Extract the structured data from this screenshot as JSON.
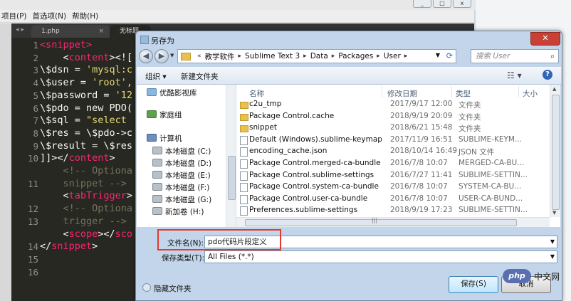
{
  "sublime": {
    "menu": [
      "项目(P)",
      "首选项(N)",
      "帮助(H)"
    ],
    "tab_nav": "◂ ▸",
    "tabs": [
      {
        "label": "1.php",
        "close": "×"
      },
      {
        "label": "无标题"
      }
    ],
    "line_numbers": [
      "1",
      "2",
      "3",
      "4",
      "5",
      "6",
      "7",
      "8",
      "9",
      "10",
      "",
      "11",
      "",
      "12",
      "13",
      "",
      "14",
      "15",
      "16"
    ],
    "code_lines": [
      [
        {
          "t": "<",
          "c": "tag"
        },
        {
          "t": "snippet",
          "c": "tag"
        },
        {
          "t": ">",
          "c": "tag"
        }
      ],
      [
        {
          "t": "    <",
          "c": "p"
        },
        {
          "t": "content",
          "c": "tag"
        },
        {
          "t": "><![",
          "c": "p"
        }
      ],
      [
        {
          "t": "\\$dsn = ",
          "c": "p"
        },
        {
          "t": "'mysql:c",
          "c": "str"
        }
      ],
      [
        {
          "t": "\\$user = ",
          "c": "p"
        },
        {
          "t": "'root',",
          "c": "str"
        }
      ],
      [
        {
          "t": "\\$password = ",
          "c": "p"
        },
        {
          "t": "'12",
          "c": "str"
        }
      ],
      [
        {
          "t": "\\$pdo = new PDO(",
          "c": "p"
        }
      ],
      [
        {
          "t": "\\$sql = ",
          "c": "p"
        },
        {
          "t": "\"select ",
          "c": "str"
        }
      ],
      [
        {
          "t": "\\$res = \\$pdo->c",
          "c": "p"
        }
      ],
      [
        {
          "t": "\\$result = \\$res",
          "c": "p"
        }
      ],
      [
        {
          "t": "]]></",
          "c": "p"
        },
        {
          "t": "content",
          "c": "tag"
        },
        {
          "t": ">",
          "c": "p"
        }
      ],
      [
        {
          "t": "    <!-- Optiona",
          "c": "cmt"
        }
      ],
      [
        {
          "t": "    snippet -->",
          "c": "cmt"
        }
      ],
      [
        {
          "t": "    <",
          "c": "p"
        },
        {
          "t": "tabTrigger",
          "c": "tag"
        },
        {
          "t": ">",
          "c": "p"
        }
      ],
      [
        {
          "t": "    <!-- Optiona",
          "c": "cmt"
        }
      ],
      [
        {
          "t": "    trigger -->",
          "c": "cmt"
        }
      ],
      [
        {
          "t": "    <",
          "c": "p"
        },
        {
          "t": "scope",
          "c": "tag"
        },
        {
          "t": "></",
          "c": "p"
        },
        {
          "t": "sco",
          "c": "tag"
        }
      ],
      [
        {
          "t": "</",
          "c": "p"
        },
        {
          "t": "snippet",
          "c": "tag"
        },
        {
          "t": ">",
          "c": "p"
        }
      ],
      [
        {
          "t": "",
          "c": "p"
        }
      ]
    ]
  },
  "dialog": {
    "title": "另存为",
    "close": "✕",
    "address": [
      "教学软件",
      "Sublime Text 3",
      "Data",
      "Packages",
      "User"
    ],
    "search_placeholder": "搜索 User",
    "organize": "组织 ▾",
    "new_folder": "新建文件夹",
    "nav_items": [
      {
        "label": "优酷影视库",
        "kind": "cloud"
      },
      {
        "label": "家庭组",
        "kind": "home"
      },
      {
        "label": "计算机",
        "kind": "comp"
      },
      {
        "label": "本地磁盘 (C:)",
        "kind": "disk"
      },
      {
        "label": "本地磁盘 (D:)",
        "kind": "disk"
      },
      {
        "label": "本地磁盘 (E:)",
        "kind": "disk"
      },
      {
        "label": "本地磁盘 (F:)",
        "kind": "disk"
      },
      {
        "label": "本地磁盘 (G:)",
        "kind": "disk"
      },
      {
        "label": "新加卷 (H:)",
        "kind": "disk"
      }
    ],
    "columns": {
      "name": "名称",
      "date": "修改日期",
      "type": "类型",
      "size": "大小"
    },
    "files": [
      {
        "name": "c2u_tmp",
        "date": "2017/9/17 12:00",
        "type": "文件夹",
        "folder": true
      },
      {
        "name": "Package Control.cache",
        "date": "2018/9/19 20:09",
        "type": "文件夹",
        "folder": true
      },
      {
        "name": "snippet",
        "date": "2018/6/21 15:48",
        "type": "文件夹",
        "folder": true
      },
      {
        "name": "Default (Windows).sublime-keymap",
        "date": "2017/11/9 16:51",
        "type": "SUBLIME-KEYM...",
        "folder": false
      },
      {
        "name": "encoding_cache.json",
        "date": "2018/10/14 16:49",
        "type": "JSON 文件",
        "folder": false
      },
      {
        "name": "Package Control.merged-ca-bundle",
        "date": "2016/7/8 10:07",
        "type": "MERGED-CA-BU...",
        "folder": false
      },
      {
        "name": "Package Control.sublime-settings",
        "date": "2016/7/27 11:41",
        "type": "SUBLIME-SETTIN...",
        "folder": false
      },
      {
        "name": "Package Control.system-ca-bundle",
        "date": "2016/7/8 10:07",
        "type": "SYSTEM-CA-BU...",
        "folder": false
      },
      {
        "name": "Package Control.user-ca-bundle",
        "date": "2016/7/8 10:07",
        "type": "USER-CA-BUND...",
        "folder": false
      },
      {
        "name": "Preferences.sublime-settings",
        "date": "2018/9/19 17:23",
        "type": "SUBLIME-SETTIN...",
        "folder": false
      }
    ],
    "filename_label": "文件名(N):",
    "filename_value": "pdo代码片段定义",
    "filetype_label": "保存类型(T):",
    "filetype_value": "All Files (*.*)",
    "hide_folders": "隐藏文件夹",
    "save": "保存(S)",
    "cancel": "取消"
  },
  "watermark": {
    "logo": "php",
    "text": "中文网"
  }
}
